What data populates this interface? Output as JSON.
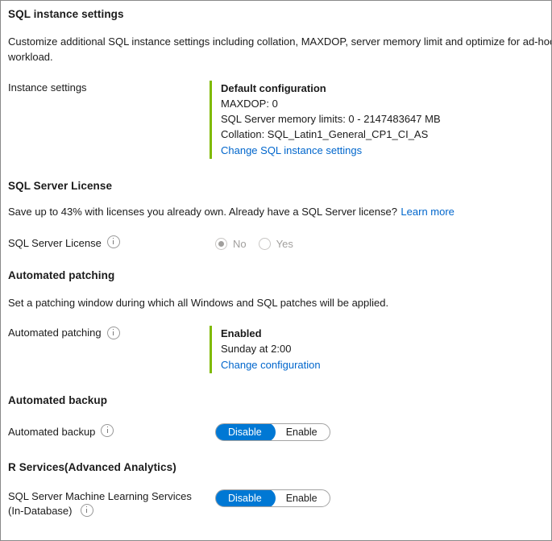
{
  "colors": {
    "accent_green": "#7fba00",
    "link_blue": "#0066cc",
    "toggle_blue": "#0078d4",
    "disabled_grey": "#a19f9d",
    "text": "#1b1b1b",
    "border": "#8a8a8a"
  },
  "sections": {
    "instance": {
      "title": "SQL instance settings",
      "description": "Customize additional SQL instance settings including collation, MAXDOP, server memory limit and optimize for ad-hoc workload.",
      "row_label": "Instance settings",
      "summary_title": "Default configuration",
      "summary_lines": [
        "MAXDOP: 0",
        "SQL Server memory limits: 0 - 2147483647 MB",
        "Collation: SQL_Latin1_General_CP1_CI_AS"
      ],
      "link": "Change SQL instance settings"
    },
    "license": {
      "title": "SQL Server License",
      "description": "Save up to 43% with licenses you already own. Already have a SQL Server license?",
      "learn_more": "Learn more",
      "row_label": "SQL Server License",
      "info_icon": "info-circle-icon",
      "options": [
        {
          "label": "No",
          "selected": true
        },
        {
          "label": "Yes",
          "selected": false
        }
      ],
      "disabled": true
    },
    "patching": {
      "title": "Automated patching",
      "description": "Set a patching window during which all Windows and SQL patches will be applied.",
      "row_label": "Automated patching",
      "info_icon": "info-circle-icon",
      "summary_title": "Enabled",
      "summary_lines": [
        "Sunday at 2:00"
      ],
      "link": "Change configuration"
    },
    "backup": {
      "title": "Automated backup",
      "row_label": "Automated backup",
      "info_icon": "info-circle-icon",
      "toggle": {
        "options": [
          "Disable",
          "Enable"
        ],
        "selected": "Disable"
      }
    },
    "rservices": {
      "title": "R Services(Advanced Analytics)",
      "row_label_line1": "SQL Server Machine Learning Services",
      "row_label_line2": "(In-Database)",
      "info_icon": "info-circle-icon",
      "toggle": {
        "options": [
          "Disable",
          "Enable"
        ],
        "selected": "Disable"
      }
    }
  }
}
